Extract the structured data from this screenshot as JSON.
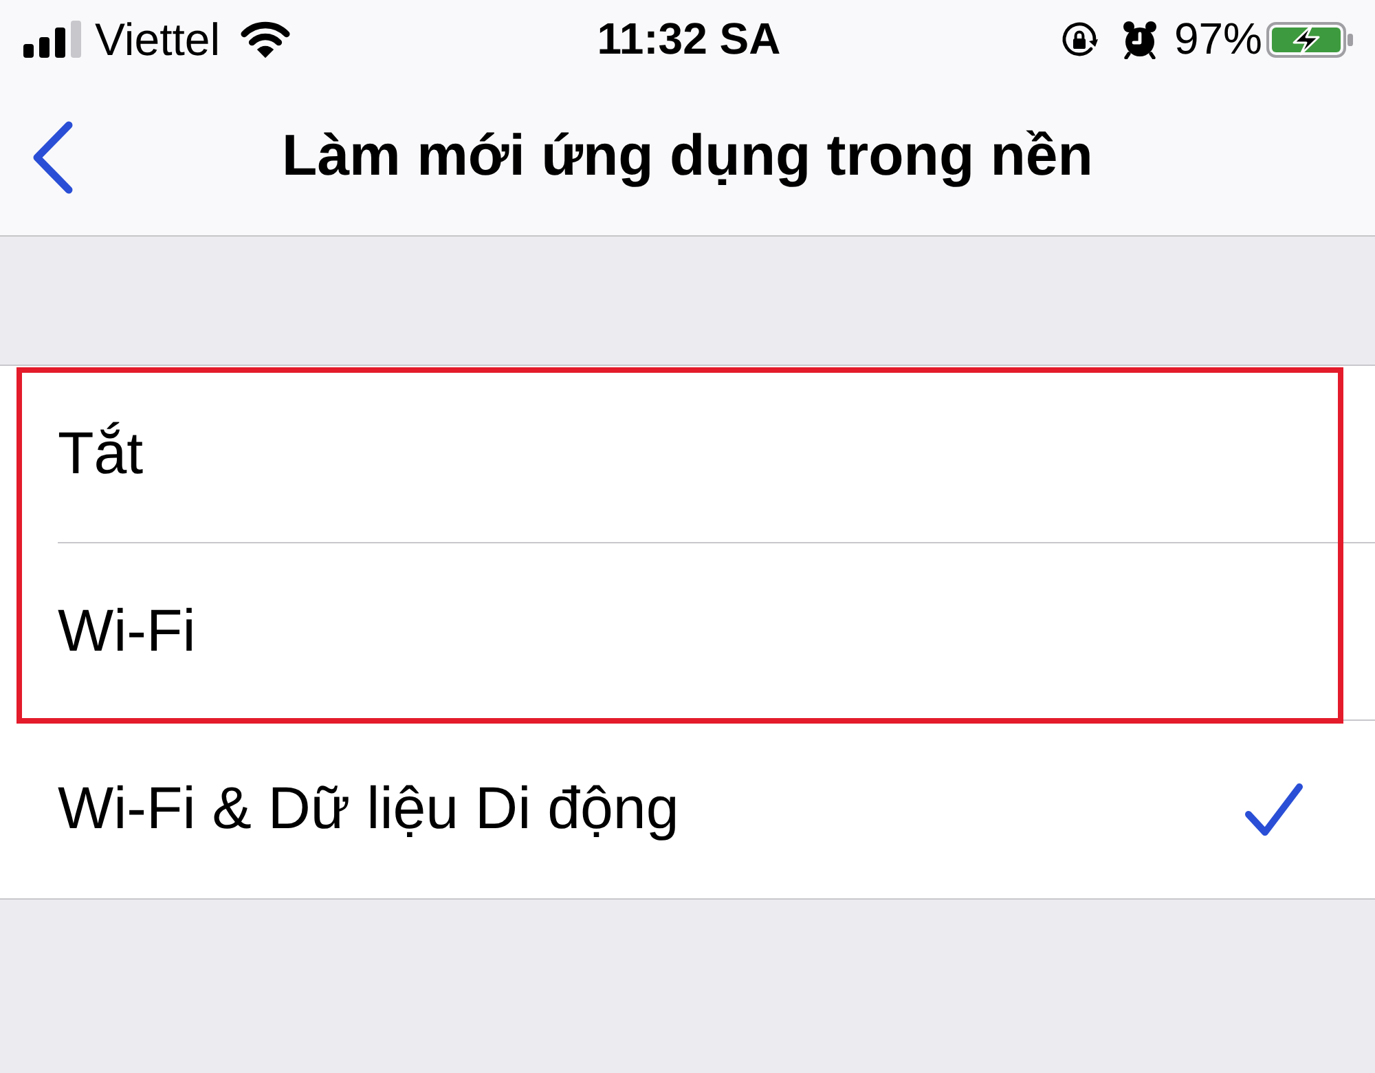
{
  "status_bar": {
    "carrier": "Viettel",
    "time": "11:32 SA",
    "battery": "97%"
  },
  "nav_bar": {
    "title": "Làm mới ứng dụng trong nền"
  },
  "options": [
    {
      "label": "Tắt",
      "selected": false,
      "highlighted": true
    },
    {
      "label": "Wi-Fi",
      "selected": false,
      "highlighted": true
    },
    {
      "label": "Wi-Fi & Dữ liệu Di động",
      "selected": true,
      "highlighted": false
    }
  ]
}
